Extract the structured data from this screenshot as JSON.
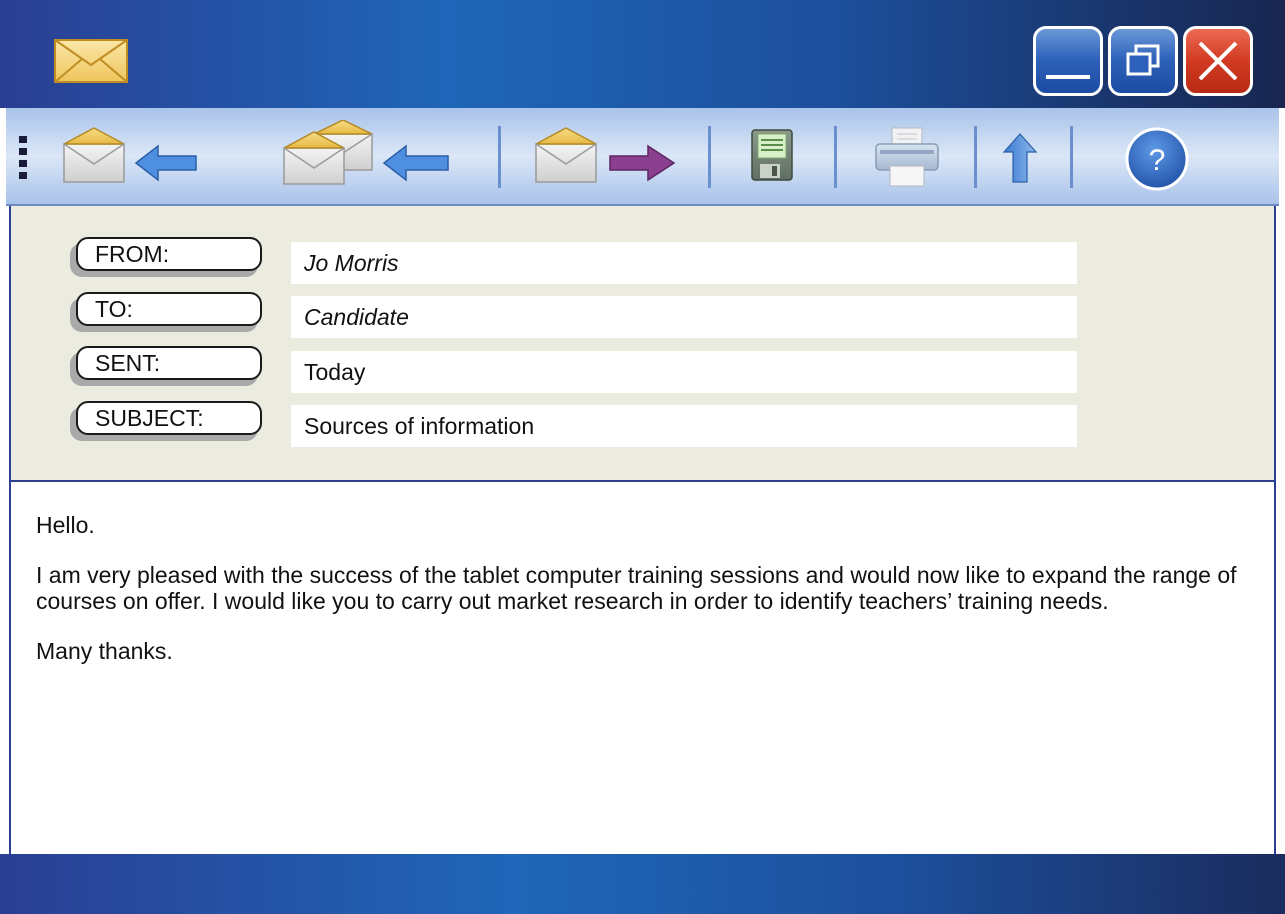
{
  "window": {
    "controls": {
      "minimize_icon": "minimize-icon",
      "maximize_icon": "restore-icon",
      "close_icon": "close-icon"
    },
    "colors": {
      "titlebar": "#1f66b8",
      "close": "#d23a22"
    }
  },
  "toolbar": {
    "icons": [
      "reply-icon",
      "reply-all-icon",
      "forward-icon",
      "save-icon",
      "print-icon",
      "up-icon",
      "help-icon"
    ],
    "help_label": "?"
  },
  "header": {
    "from_label": "FROM:",
    "from_value": "Jo Morris",
    "to_label": "TO:",
    "to_value": "Candidate",
    "sent_label": "SENT:",
    "sent_value": "Today",
    "subject_label": "SUBJECT:",
    "subject_value": "Sources of information"
  },
  "message": {
    "greeting": "Hello.",
    "body": "I am very pleased with the success of the tablet computer training sessions and would now like to expand the range of courses on offer. I would like you to carry out market research in order to identify teachers’ training needs.",
    "closing": "Many thanks."
  }
}
